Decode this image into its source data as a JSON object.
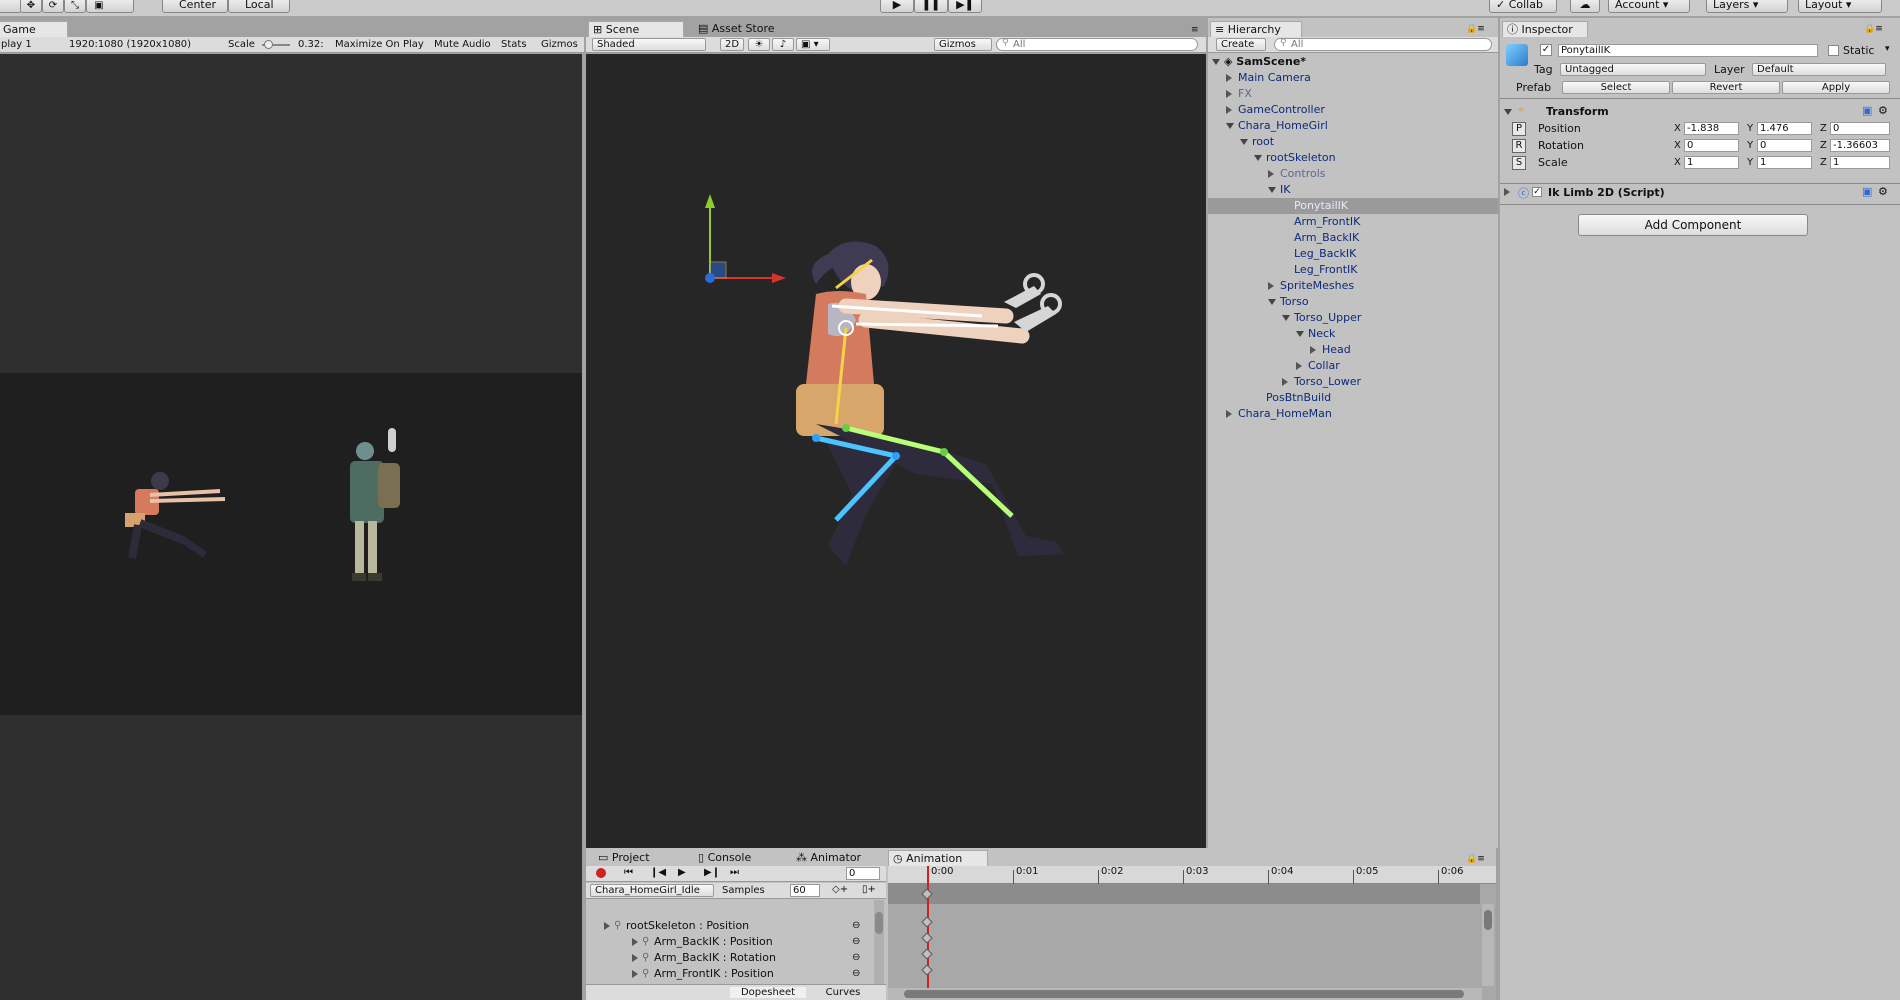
{
  "toolbar": {
    "center": "Center",
    "local": "Local",
    "collab": "Collab",
    "account": "Account",
    "layers": "Layers",
    "layout": "Layout"
  },
  "game": {
    "tab": "Game",
    "display": "play 1",
    "resolution": "1920:1080 (1920x1080)",
    "scale_label": "Scale",
    "scale_value": "0.32:",
    "maximize": "Maximize On Play",
    "mute": "Mute Audio",
    "stats": "Stats",
    "gizmos": "Gizmos"
  },
  "scene": {
    "tab": "Scene",
    "asset_store": "Asset Store",
    "shading": "Shaded",
    "mode2d": "2D",
    "gizmos": "Gizmos",
    "search_placeholder": "All"
  },
  "hierarchy": {
    "tab": "Hierarchy",
    "create": "Create",
    "search_placeholder": "All",
    "scene": "SamScene*",
    "items": [
      {
        "label": "Main Camera",
        "depth": 1,
        "arrow": "right",
        "dim": false,
        "selected": false
      },
      {
        "label": "FX",
        "depth": 1,
        "arrow": "right",
        "dim": true,
        "selected": false
      },
      {
        "label": "GameController",
        "depth": 1,
        "arrow": "right",
        "dim": false,
        "selected": false
      },
      {
        "label": "Chara_HomeGirl",
        "depth": 1,
        "arrow": "down",
        "dim": false,
        "selected": false
      },
      {
        "label": "root",
        "depth": 2,
        "arrow": "down",
        "dim": false,
        "selected": false
      },
      {
        "label": "rootSkeleton",
        "depth": 3,
        "arrow": "down",
        "dim": false,
        "selected": false
      },
      {
        "label": "Controls",
        "depth": 4,
        "arrow": "right",
        "dim": true,
        "selected": false
      },
      {
        "label": "IK",
        "depth": 4,
        "arrow": "down",
        "dim": false,
        "selected": false
      },
      {
        "label": "PonytailIK",
        "depth": 5,
        "arrow": "none",
        "dim": false,
        "selected": true
      },
      {
        "label": "Arm_FrontIK",
        "depth": 5,
        "arrow": "none",
        "dim": false,
        "selected": false
      },
      {
        "label": "Arm_BackIK",
        "depth": 5,
        "arrow": "none",
        "dim": false,
        "selected": false
      },
      {
        "label": "Leg_BackIK",
        "depth": 5,
        "arrow": "none",
        "dim": false,
        "selected": false
      },
      {
        "label": "Leg_FrontIK",
        "depth": 5,
        "arrow": "none",
        "dim": false,
        "selected": false
      },
      {
        "label": "SpriteMeshes",
        "depth": 4,
        "arrow": "right",
        "dim": false,
        "selected": false
      },
      {
        "label": "Torso",
        "depth": 4,
        "arrow": "down",
        "dim": false,
        "selected": false
      },
      {
        "label": "Torso_Upper",
        "depth": 5,
        "arrow": "down",
        "dim": false,
        "selected": false
      },
      {
        "label": "Neck",
        "depth": 6,
        "arrow": "down",
        "dim": false,
        "selected": false
      },
      {
        "label": "Head",
        "depth": 7,
        "arrow": "right",
        "dim": false,
        "selected": false
      },
      {
        "label": "Collar",
        "depth": 6,
        "arrow": "right",
        "dim": false,
        "selected": false
      },
      {
        "label": "Torso_Lower",
        "depth": 5,
        "arrow": "right",
        "dim": false,
        "selected": false
      },
      {
        "label": "PosBtnBuild",
        "depth": 3,
        "arrow": "none",
        "dim": false,
        "selected": false
      },
      {
        "label": "Chara_HomeMan",
        "depth": 1,
        "arrow": "right",
        "dim": false,
        "selected": false
      }
    ]
  },
  "inspector": {
    "tab": "Inspector",
    "name": "PonytailIK",
    "static": "Static",
    "tag_label": "Tag",
    "tag": "Untagged",
    "layer_label": "Layer",
    "layer": "Default",
    "prefab_label": "Prefab",
    "select": "Select",
    "revert": "Revert",
    "apply": "Apply",
    "transform": {
      "title": "Transform",
      "position_label": "Position",
      "rotation_label": "Rotation",
      "scale_label": "Scale",
      "position": {
        "x": "-1.838",
        "y": "1.476",
        "z": "0"
      },
      "rotation": {
        "x": "0",
        "y": "0",
        "z": "-1.36603"
      },
      "scale": {
        "x": "1",
        "y": "1",
        "z": "1"
      }
    },
    "component": "Ik Limb 2D (Script)",
    "add_component": "Add Component",
    "axis": {
      "x": "X",
      "y": "Y",
      "z": "Z"
    },
    "badges": {
      "p": "P",
      "r": "R",
      "s": "S"
    }
  },
  "bottom": {
    "tabs": {
      "project": "Project",
      "console": "Console",
      "animator": "Animator",
      "animation": "Animation"
    },
    "frame": "0",
    "clip": "Chara_HomeGirl_Idle",
    "samples_label": "Samples",
    "samples": "60",
    "ticks": [
      "0:00",
      "0:01",
      "0:02",
      "0:03",
      "0:04",
      "0:05",
      "0:06"
    ],
    "props": [
      "rootSkeleton : Position",
      "Arm_BackIK : Position",
      "Arm_BackIK : Rotation",
      "Arm_FrontIK : Position"
    ],
    "dopesheet": "Dopesheet",
    "curves": "Curves"
  },
  "colors": {
    "record": "#d02020",
    "selected": "#9a9a9a",
    "link": "#0c2a7a"
  }
}
